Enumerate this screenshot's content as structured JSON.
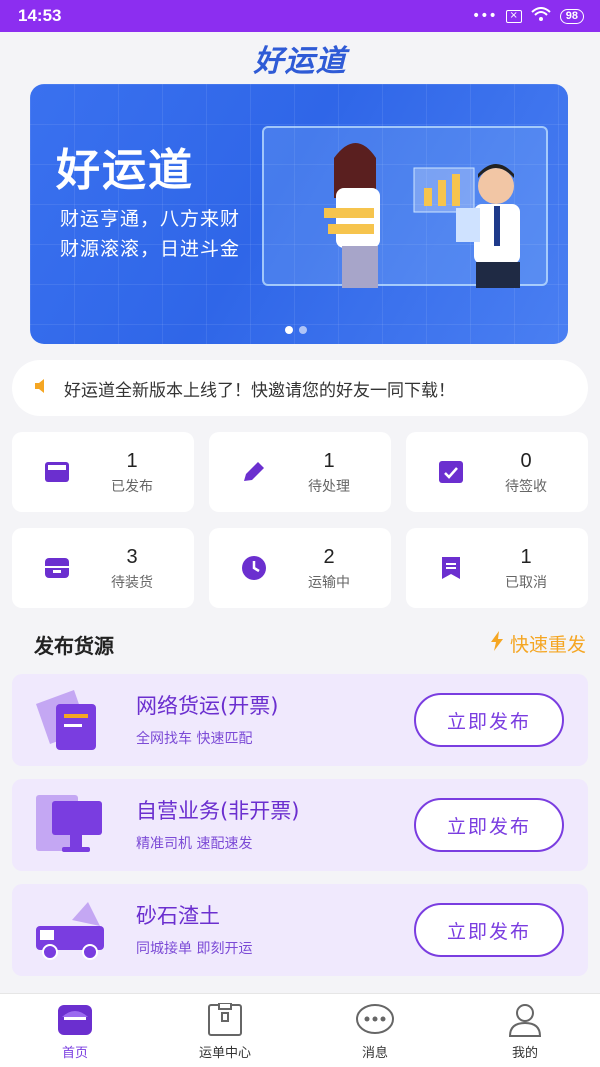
{
  "status_bar": {
    "time": "14:53",
    "signal_dots": "•••",
    "sim": "×",
    "wifi": "wifi-icon",
    "battery": "98"
  },
  "header": {
    "logo_text": "好运道"
  },
  "banner": {
    "title": "好运道",
    "line1": "财运亨通，八方来财",
    "line2": "财源滚滚，日进斗金"
  },
  "notice": {
    "icon": "speaker-icon",
    "text": "好运道全新版本上线了！快邀请您的好友一同下载！"
  },
  "stats": [
    {
      "num": "1",
      "label": "已发布",
      "icon": "published-icon"
    },
    {
      "num": "1",
      "label": "待处理",
      "icon": "pencil-icon"
    },
    {
      "num": "0",
      "label": "待签收",
      "icon": "sign-icon"
    },
    {
      "num": "3",
      "label": "待装货",
      "icon": "load-icon"
    },
    {
      "num": "2",
      "label": "运输中",
      "icon": "clock-icon"
    },
    {
      "num": "1",
      "label": "已取消",
      "icon": "cancel-icon"
    }
  ],
  "section": {
    "title": "发布货源",
    "quick_label": "快速重发"
  },
  "publish": [
    {
      "title": "网络货运(开票)",
      "sub": "全网找车 快速匹配",
      "button": "立即发布",
      "icon": "document-icon"
    },
    {
      "title": "自营业务(非开票)",
      "sub": "精准司机 速配速发",
      "button": "立即发布",
      "icon": "monitor-icon"
    },
    {
      "title": "砂石渣土",
      "sub": "同城接单 即刻开运",
      "button": "立即发布",
      "icon": "truck-icon"
    }
  ],
  "nav": [
    {
      "label": "首页",
      "icon": "home-icon"
    },
    {
      "label": "运单中心",
      "icon": "waybill-icon"
    },
    {
      "label": "消息",
      "icon": "message-icon"
    },
    {
      "label": "我的",
      "icon": "profile-icon"
    }
  ],
  "colors": {
    "accent": "#7a3de0",
    "status_bar": "#8c2ef0",
    "banner": "#3a71ef",
    "highlight": "#f5a623"
  }
}
